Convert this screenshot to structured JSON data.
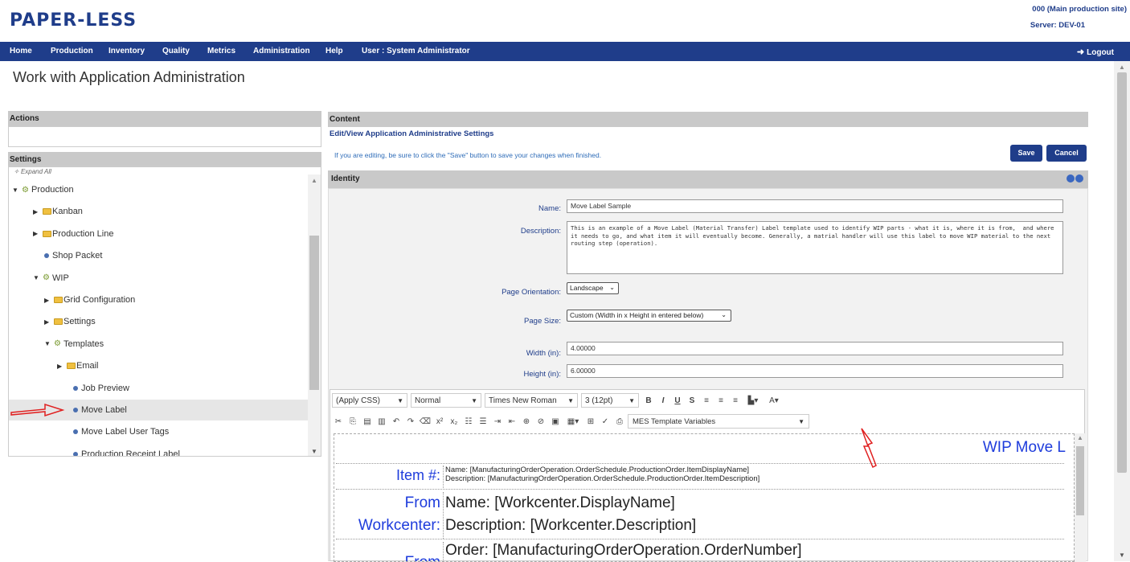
{
  "header": {
    "logo": "PAPER-LESS",
    "site": "000 (Main production site)",
    "server": "Server: DEV-01"
  },
  "nav": {
    "items": [
      "Home",
      "Production",
      "Inventory",
      "Quality",
      "Metrics",
      "Administration",
      "Help",
      "User : System Administrator"
    ],
    "logout": "Logout"
  },
  "page_title": "Work with Application Administration",
  "left": {
    "actions_header": "Actions",
    "settings_header": "Settings",
    "expand_all": "Expand All",
    "tree": [
      {
        "label": "Production",
        "kind": "gear",
        "caret": "▼"
      },
      {
        "label": "Kanban",
        "kind": "folder",
        "caret": "▶"
      },
      {
        "label": "Production Line",
        "kind": "folder",
        "caret": "▶"
      },
      {
        "label": "Shop Packet",
        "kind": "dot",
        "caret": ""
      },
      {
        "label": "WIP",
        "kind": "gear",
        "caret": "▼"
      },
      {
        "label": "Grid Configuration",
        "kind": "folder",
        "caret": "▶"
      },
      {
        "label": "Settings",
        "kind": "folder",
        "caret": "▶"
      },
      {
        "label": "Templates",
        "kind": "gear",
        "caret": "▼"
      },
      {
        "label": "Email",
        "kind": "folder",
        "caret": "▶"
      },
      {
        "label": "Job Preview",
        "kind": "dot",
        "caret": ""
      },
      {
        "label": "Move Label",
        "kind": "dot",
        "caret": "",
        "selected": true
      },
      {
        "label": "Move Label User Tags",
        "kind": "dot",
        "caret": ""
      },
      {
        "label": "Production Receipt Label",
        "kind": "dot",
        "caret": ""
      }
    ]
  },
  "content": {
    "header": "Content",
    "subtitle": "Edit/View Application Administrative Settings",
    "hint": "If you are editing, be sure to click the \"Save\" button to save your changes when finished.",
    "save": "Save",
    "cancel": "Cancel",
    "identity_header": "Identity"
  },
  "form": {
    "name_label": "Name:",
    "name_value": "Move Label Sample",
    "desc_label": "Description:",
    "desc_value": "This is an example of a Move Label (Material Transfer) Label template used to identify WIP parts - what it is, where it is from,  and where it needs to go, and what item it will eventually become. Generally, a matrial handler will use this label to move WIP material to the next routing step (operation).",
    "orient_label": "Page Orientation:",
    "orient_value": "Landscape",
    "size_label": "Page Size:",
    "size_value": "Custom (Width in x Height in entered below)",
    "width_label": "Width (in):",
    "width_value": "4.00000",
    "height_label": "Height (in):",
    "height_value": "6.00000"
  },
  "editor": {
    "css": "(Apply CSS)",
    "format": "Normal",
    "font": "Times New Roman",
    "size": "3 (12pt)",
    "mes_vars": "MES Template Variables",
    "label_title": "WIP Move L",
    "rows": [
      {
        "left": "Item #:",
        "right1": "Name:  [ManufacturingOrderOperation.OrderSchedule.ProductionOrder.ItemDisplayName]",
        "right2": "Description:  [ManufacturingOrderOperation.OrderSchedule.ProductionOrder.ItemDescription]"
      },
      {
        "left1": "From",
        "left2": "Workcenter:",
        "right1": "Name:  [Workcenter.DisplayName]",
        "right2": "Description:  [Workcenter.Description]"
      },
      {
        "left": "From",
        "right": "Order:  [ManufacturingOrderOperation.OrderNumber]"
      }
    ]
  },
  "colors": {
    "brand": "#1f3d8a",
    "label_blue": "#1e3cdc",
    "arrow": "#e02020"
  }
}
